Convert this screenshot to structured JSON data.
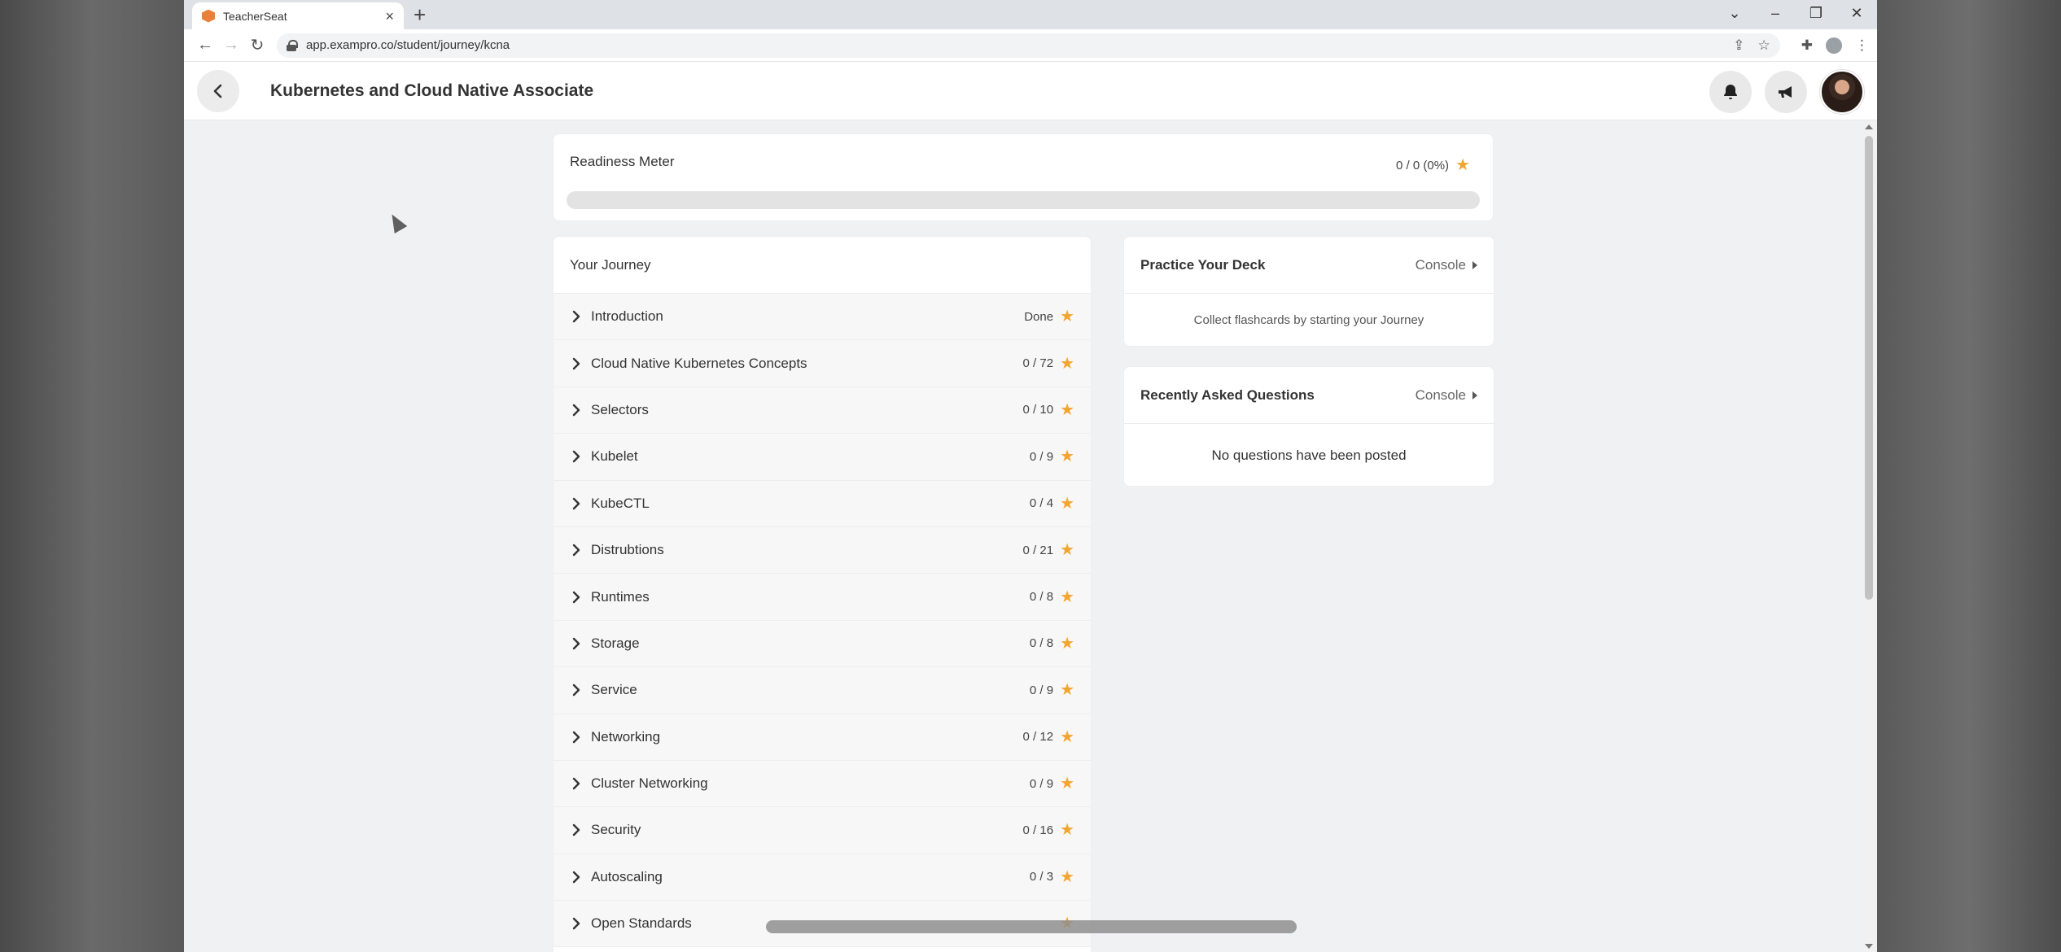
{
  "browser": {
    "tab_title": "TeacherSeat",
    "url": "app.exampro.co/student/journey/kcna",
    "new_tab_label": "+"
  },
  "header": {
    "title": "Kubernetes and Cloud Native Associate"
  },
  "readiness": {
    "title": "Readiness Meter",
    "score": "0 / 0 (0%)",
    "progress_percent": 0
  },
  "journey": {
    "title": "Your Journey",
    "items": [
      {
        "label": "Introduction",
        "progress": "Done"
      },
      {
        "label": "Cloud Native Kubernetes Concepts",
        "progress": "0 / 72"
      },
      {
        "label": "Selectors",
        "progress": "0 / 10"
      },
      {
        "label": "Kubelet",
        "progress": "0 / 9"
      },
      {
        "label": "KubeCTL",
        "progress": "0 / 4"
      },
      {
        "label": "Distrubtions",
        "progress": "0 / 21"
      },
      {
        "label": "Runtimes",
        "progress": "0 / 8"
      },
      {
        "label": "Storage",
        "progress": "0 / 8"
      },
      {
        "label": "Service",
        "progress": "0 / 9"
      },
      {
        "label": "Networking",
        "progress": "0 / 12"
      },
      {
        "label": "Cluster Networking",
        "progress": "0 / 9"
      },
      {
        "label": "Security",
        "progress": "0 / 16"
      },
      {
        "label": "Autoscaling",
        "progress": "0 / 3"
      },
      {
        "label": "Open Standards",
        "progress": ""
      }
    ]
  },
  "practice": {
    "title": "Practice Your Deck",
    "console_label": "Console",
    "body": "Collect flashcards by starting your Journey"
  },
  "recent": {
    "title": "Recently Asked Questions",
    "console_label": "Console",
    "body": "No questions have been posted"
  },
  "colors": {
    "accent": "#f2a530",
    "favicon": "#e8803a"
  }
}
